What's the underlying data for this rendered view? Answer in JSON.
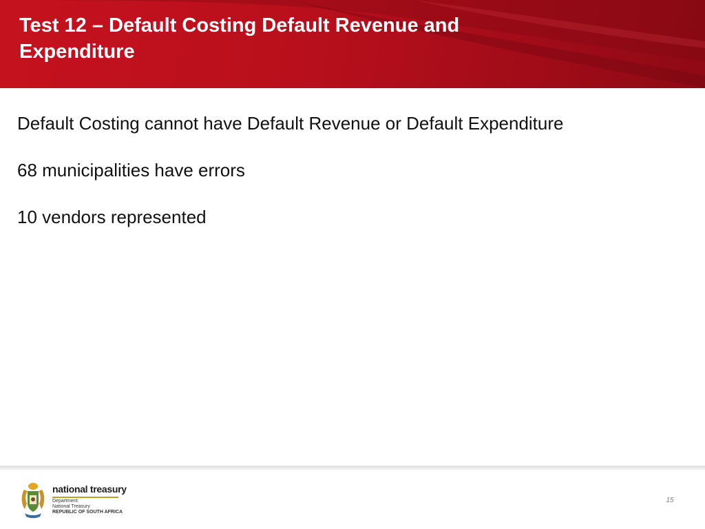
{
  "slide": {
    "title": "Test 12 – Default Costing Default Revenue and Expenditure",
    "body": [
      "Default Costing cannot have Default Revenue or Default Expenditure",
      "68 municipalities have errors",
      "10 vendors represented"
    ]
  },
  "footer": {
    "logo": {
      "name": "national treasury",
      "department_lines": [
        "Department:",
        "National Treasury",
        "REPUBLIC OF SOUTH AFRICA"
      ],
      "emblem_icon": "coat-of-arms-icon"
    },
    "page_number": "15"
  },
  "colors": {
    "header_red": "#c5121f",
    "header_dark_red": "#8e0a14",
    "title_text": "#ffffff",
    "body_text": "#111111",
    "page_number": "#7a7a7a"
  }
}
